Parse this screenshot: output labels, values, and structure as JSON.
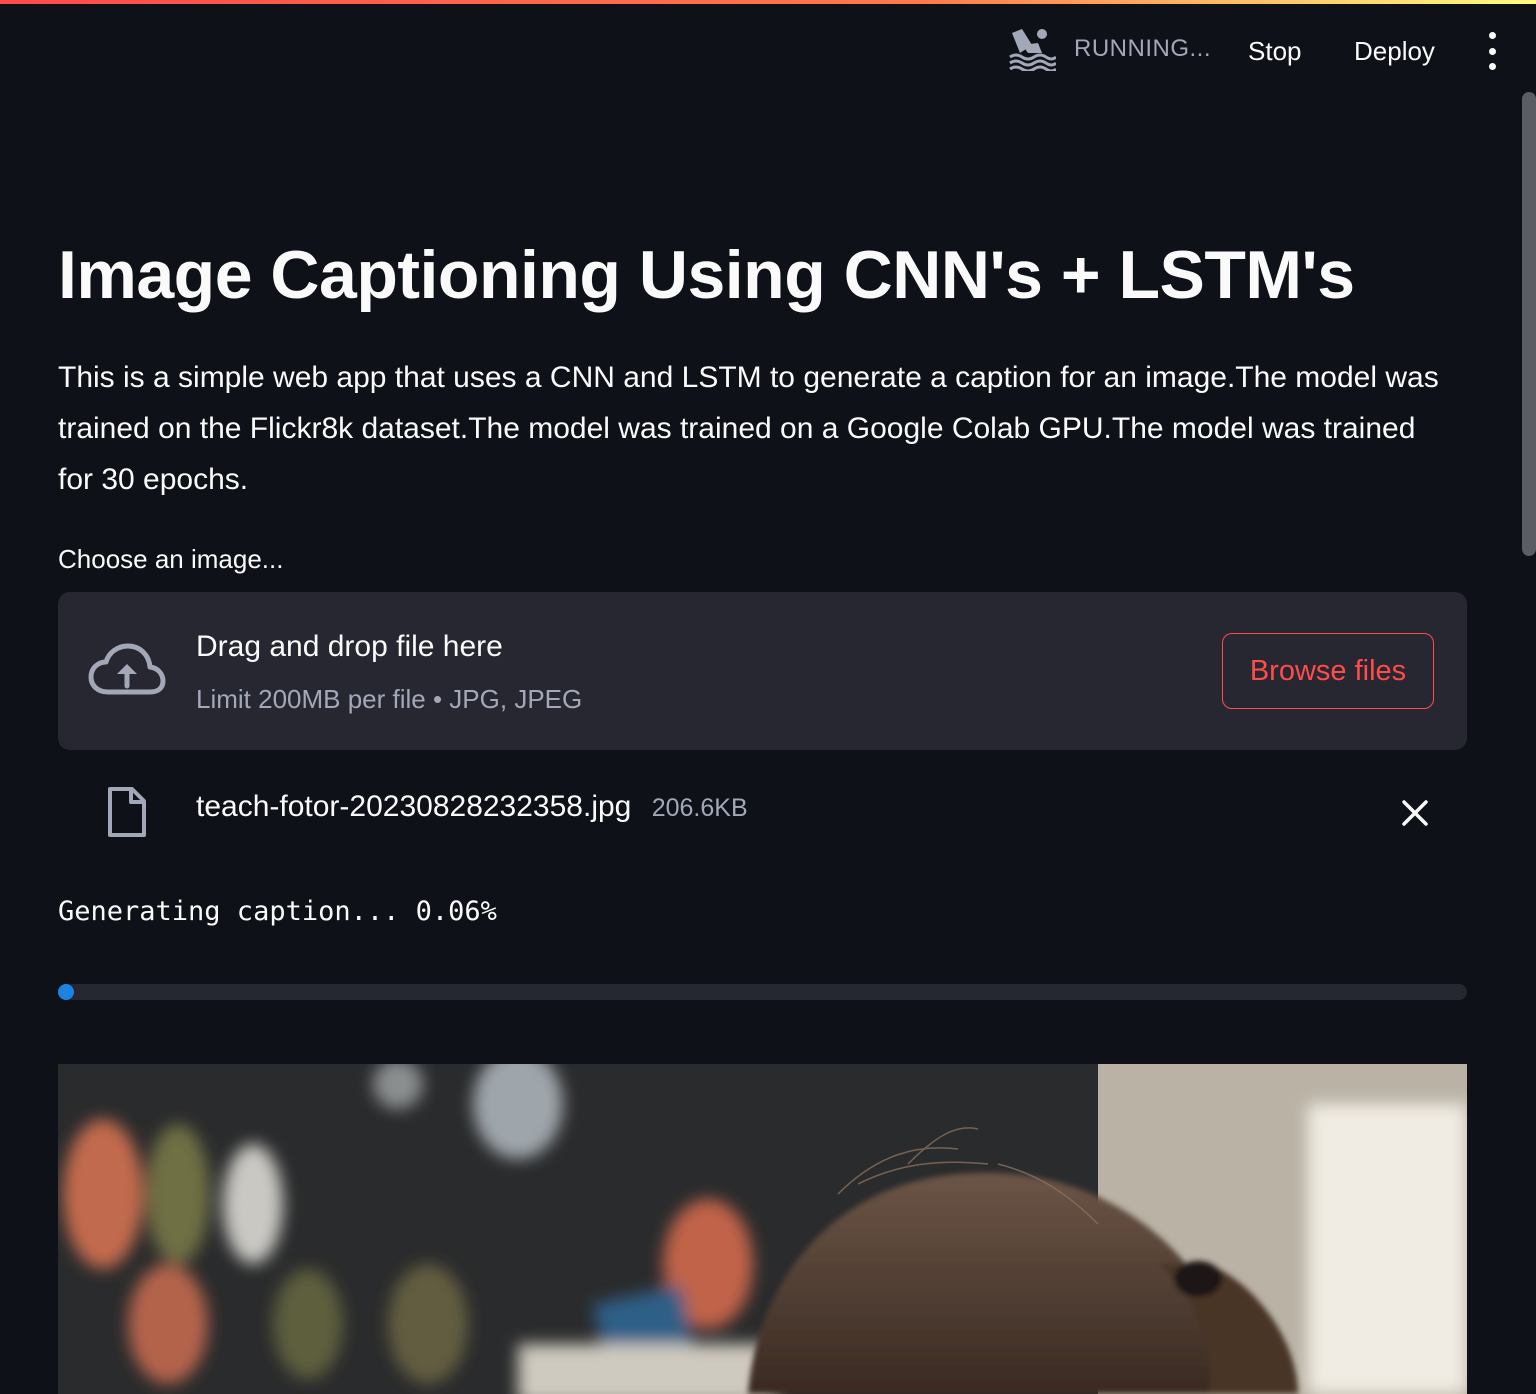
{
  "header": {
    "status": "RUNNING...",
    "stop_label": "Stop",
    "deploy_label": "Deploy"
  },
  "main": {
    "title": "Image Captioning Using CNN's + LSTM's",
    "description": "This is a simple web app that uses a CNN and LSTM to generate a caption for an image.The model was trained on the Flickr8k dataset.The model was trained on a Google Colab GPU.The model was trained for 30 epochs.",
    "uploader": {
      "label": "Choose an image...",
      "drop_title": "Drag and drop file here",
      "limit_text": "Limit 200MB per file • JPG, JPEG",
      "browse_label": "Browse files"
    },
    "uploaded_file": {
      "name": "teach-fotor-20230828232358.jpg",
      "size": "206.6KB"
    },
    "progress": {
      "text": "Generating caption... 0.06%",
      "percent": 0.06
    }
  },
  "colors": {
    "background": "#0e1117",
    "dropzone": "#262730",
    "accent": "#ff4b4b",
    "progress": "#1c83e1",
    "muted_text": "#a3a8b8"
  },
  "icons": [
    "swimmer-icon",
    "kebab-menu-icon",
    "cloud-upload-icon",
    "file-icon",
    "close-icon"
  ]
}
